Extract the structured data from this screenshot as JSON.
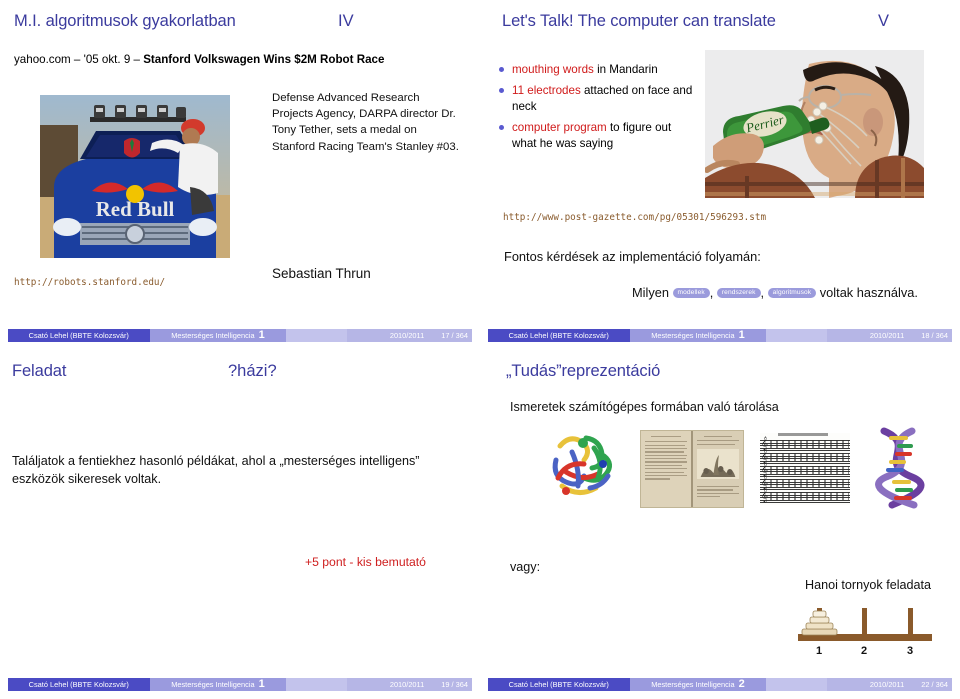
{
  "slides": [
    {
      "title": "M.I. algoritmusok gyakorlatban",
      "title_number": "IV",
      "headline_prefix": "yahoo.com – '05 okt. 9 – ",
      "headline_bold": "Stanford Volkswagen Wins $2M Robot Race",
      "caption": "Defense Advanced Research Projects Agency, DARPA director Dr. Tony Tether, sets a medal on Stanford Racing Team's Stanley #03.",
      "url": "http://robots.stanford.edu/",
      "person": "Sebastian Thrun",
      "photo_alt": "stanford-stanley-redbull-car",
      "footer": {
        "author": "Csató Lehel  (BBTE Kolozsvár)",
        "course": "Mesterséges Intelligencia",
        "frame": "1",
        "date": "2010/2011",
        "page": "17 / 364"
      }
    },
    {
      "title": "Let's Talk! The computer can translate",
      "title_number": "V",
      "bullets": [
        {
          "highlight": "mouthing words",
          "rest": " in Mandarin"
        },
        {
          "highlight": "11 electrodes",
          "rest": " attached on face and neck"
        },
        {
          "highlight": "computer program",
          "rest": " to figure out what he was saying"
        }
      ],
      "url": "http://www.post-gazette.com/pg/05301/596293.stm",
      "question": "Fontos kérdések az implementáció folyamán:",
      "milyen_prefix": "Milyen ",
      "pills": [
        "modellek",
        "rendszerek",
        "algoritmusok"
      ],
      "milyen_suffix": " voltak használva.",
      "photo_alt": "man-drinking-with-electrodes",
      "footer": {
        "author": "Csató Lehel  (BBTE Kolozsvár)",
        "course": "Mesterséges Intelligencia",
        "frame": "1",
        "date": "2010/2011",
        "page": "18 / 364"
      }
    },
    {
      "title": "Feladat",
      "title_number": "?házi?",
      "task": "Találjatok a fentiekhez hasonló példákat, ahol a „mesterséges intelligens” eszközök sikeresek voltak.",
      "bonus": "+5 pont - kis bemutató",
      "footer": {
        "author": "Csató Lehel  (BBTE Kolozsvár)",
        "course": "Mesterséges Intelligencia",
        "frame": "1",
        "date": "2010/2011",
        "page": "19 / 364"
      }
    },
    {
      "title": "„Tudás”reprezentáció",
      "title_number": "",
      "subtitle": "Ismeretek számítógépes formában való tárolása",
      "gallery": [
        "protein-ribbon-diagram",
        "open-old-book",
        "sheet-music",
        "dna-double-helix"
      ],
      "vagy": "vagy:",
      "hanoi_label": "Hanoi tornyok feladata",
      "hanoi_pegs": [
        "1",
        "2",
        "3"
      ],
      "hanoi_disks_on_peg1": 4,
      "footer": {
        "author": "Csató Lehel  (BBTE Kolozsvár)",
        "course": "Mesterséges Intelligencia",
        "frame": "2",
        "date": "2010/2011",
        "page": "22 / 364"
      }
    }
  ],
  "colors": {
    "title": "#3b3b9e",
    "highlight_red": "#d01a1a",
    "bonus_red": "#cf2020",
    "url_brown": "#8a5c2e",
    "footer_dark": "#4b4bc4",
    "footer_mid": "#9a9ade",
    "footer_light": "#b6b6e6",
    "pill_bg": "#9b9bdc",
    "hanoi_wood": "#8a5a2b"
  }
}
